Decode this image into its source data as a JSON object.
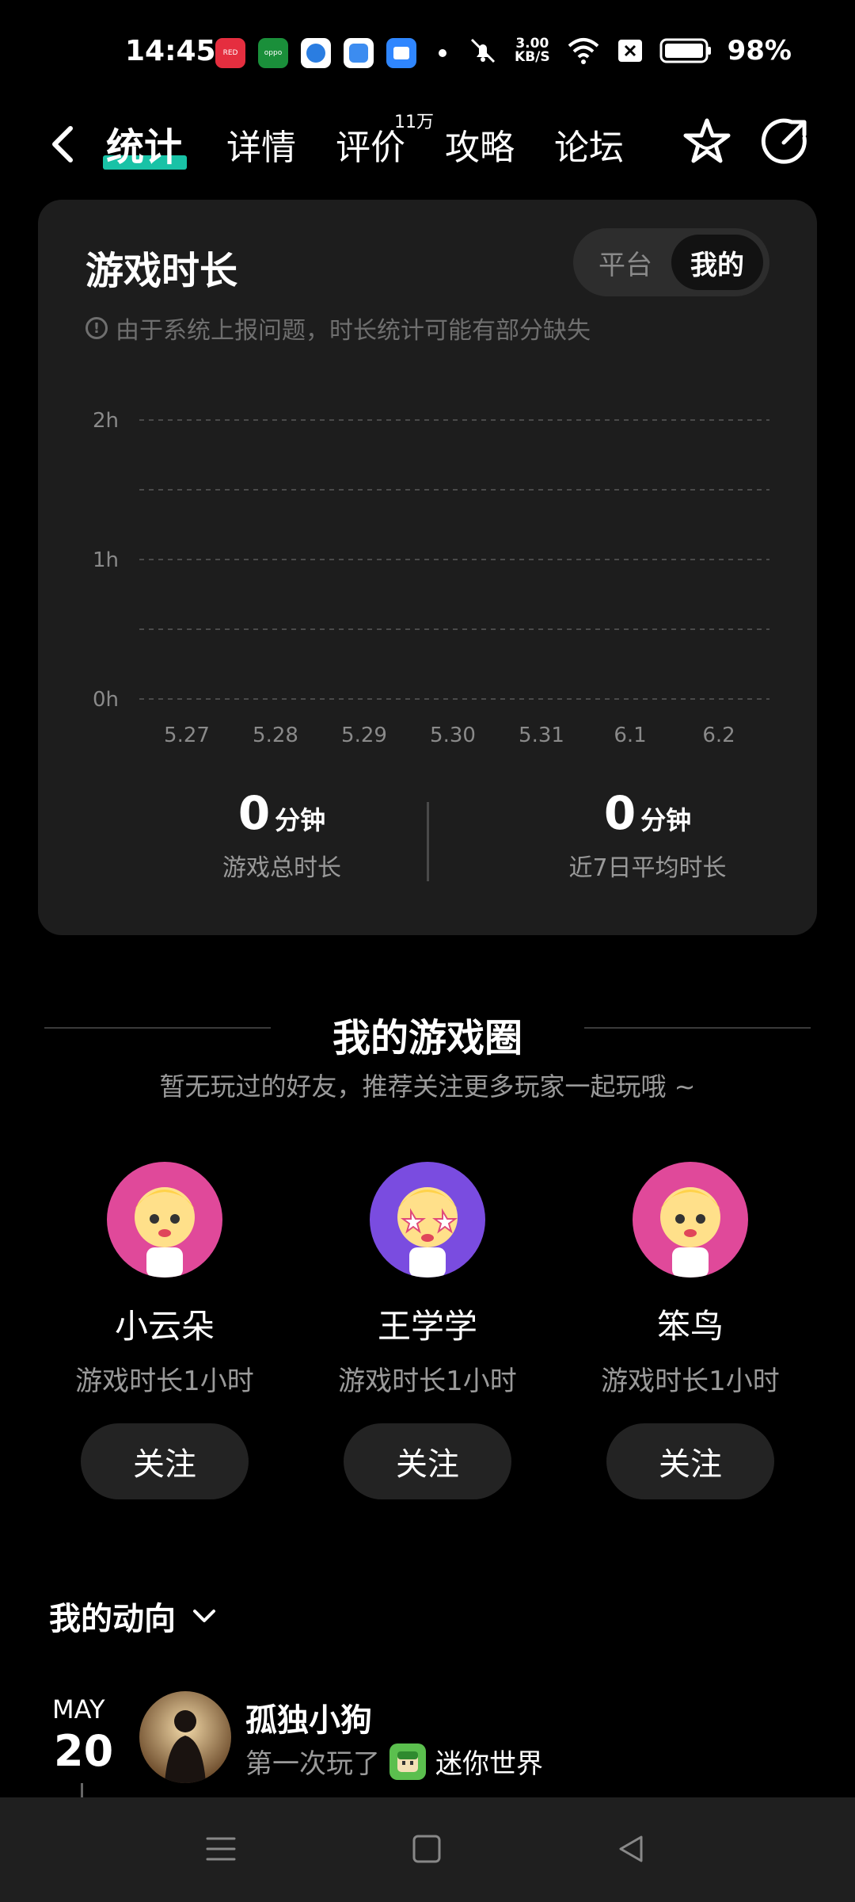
{
  "status_bar": {
    "time": "14:45",
    "net_speed_value": "3.00",
    "net_speed_unit": "KB/S",
    "battery": "98%",
    "apps": [
      {
        "name": "小红书",
        "color": "#e52e3f"
      },
      {
        "name": "oppo",
        "color": "#1a8f3a"
      },
      {
        "name": "app3",
        "color": "#2a7de1"
      },
      {
        "name": "app4",
        "color": "#3c8cf0"
      },
      {
        "name": "app5",
        "color": "#2f86ff"
      }
    ]
  },
  "nav": {
    "tabs": [
      "统计",
      "详情",
      "评价",
      "攻略",
      "论坛"
    ],
    "active_tab": "统计",
    "review_badge": "11万"
  },
  "playtime_card": {
    "title": "游戏时长",
    "segment": {
      "options": [
        "平台",
        "我的"
      ],
      "selected": "我的"
    },
    "notice": "由于系统上报问题，时长统计可能有部分缺失",
    "stats": [
      {
        "value": "0",
        "unit": "分钟",
        "label": "游戏总时长"
      },
      {
        "value": "0",
        "unit": "分钟",
        "label": "近7日平均时长"
      }
    ]
  },
  "chart_data": {
    "type": "bar",
    "categories": [
      "5.27",
      "5.28",
      "5.29",
      "5.30",
      "5.31",
      "6.1",
      "6.2"
    ],
    "values": [
      0,
      0,
      0,
      0,
      0,
      0,
      0
    ],
    "y_ticks": [
      "0h",
      "1h",
      "2h"
    ],
    "ylim": [
      0,
      2
    ],
    "grid": true,
    "xlabel": "",
    "ylabel": ""
  },
  "game_circle": {
    "title": "我的游戏圈",
    "subtitle": "暂无玩过的好友，推荐关注更多玩家一起玩哦 ~",
    "friends": [
      {
        "name": "小云朵",
        "time": "游戏时长1小时",
        "follow": "关注",
        "bg": "#e0499a"
      },
      {
        "name": "王学学",
        "time": "游戏时长1小时",
        "follow": "关注",
        "bg": "#7a4ce0"
      },
      {
        "name": "笨鸟",
        "time": "游戏时长1小时",
        "follow": "关注",
        "bg": "#e0499a"
      }
    ]
  },
  "activity": {
    "title": "我的动向",
    "month": "MAY",
    "day": "20",
    "user": "孤独小狗",
    "action": "第一次玩了",
    "game": "迷你世界"
  }
}
